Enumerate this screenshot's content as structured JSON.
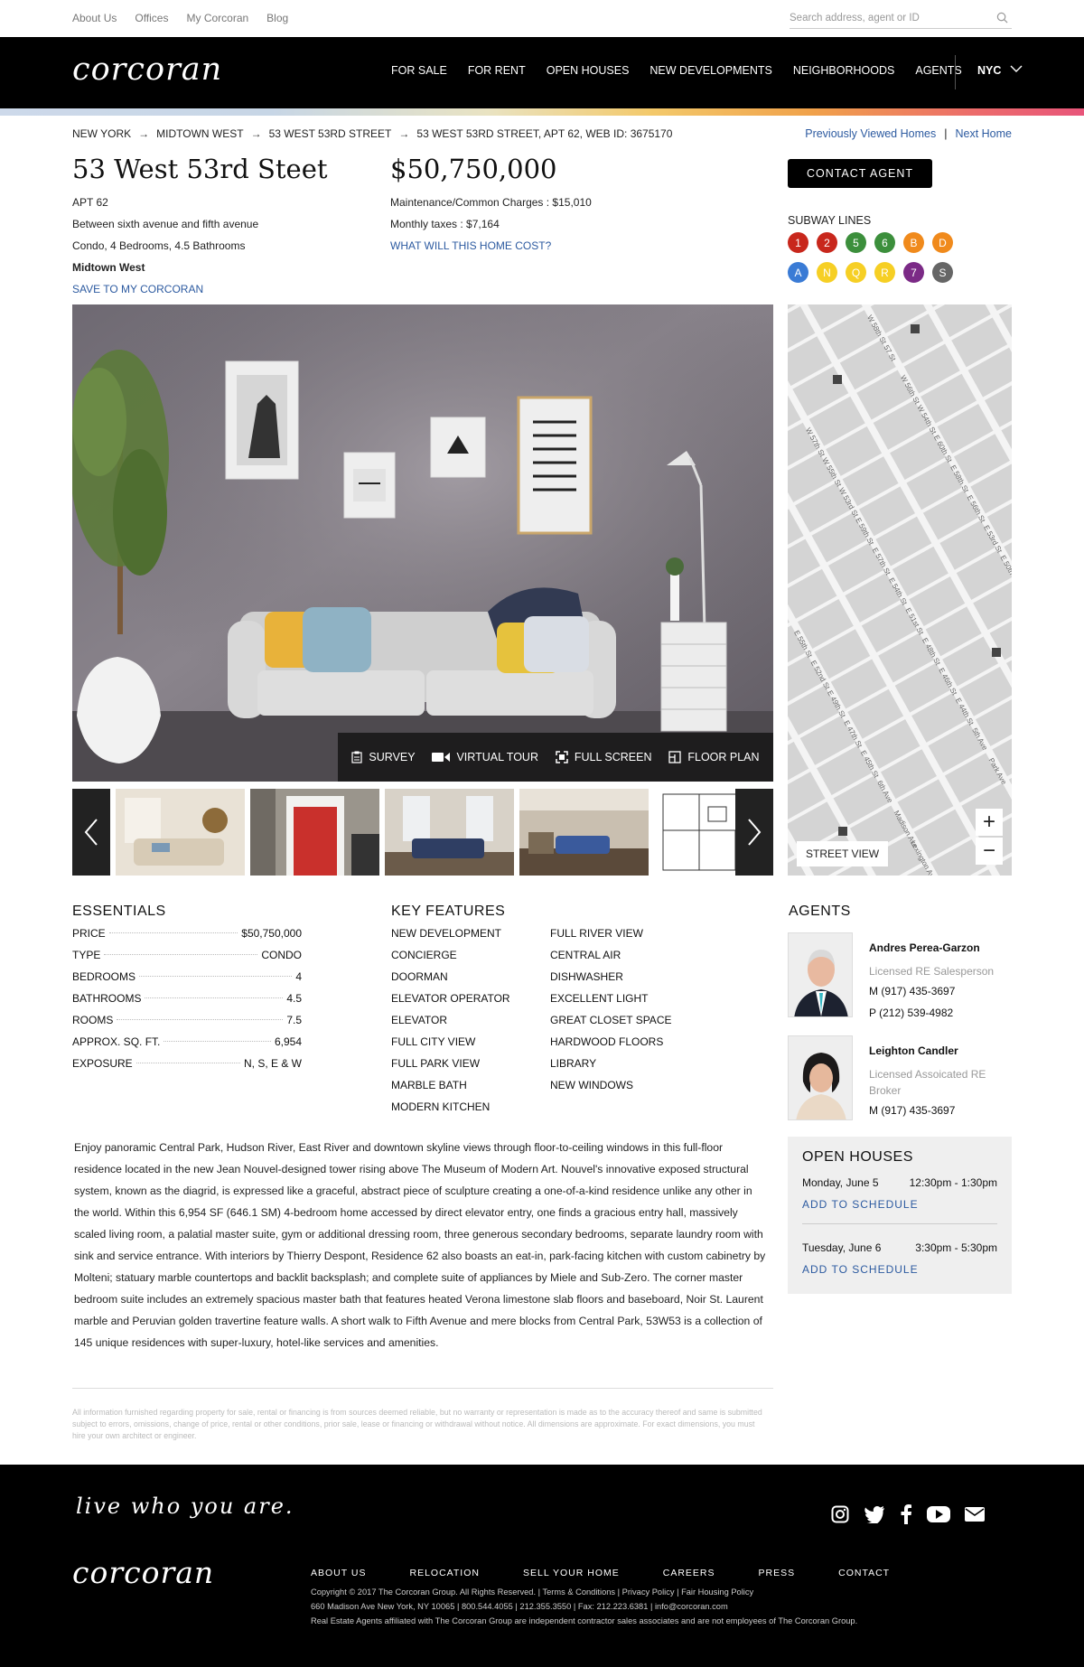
{
  "util": {
    "links": [
      "About Us",
      "Offices",
      "My Corcoran",
      "Blog"
    ],
    "search_placeholder": "Search address, agent or ID"
  },
  "header": {
    "logo": "corcoran",
    "nav": [
      "FOR SALE",
      "FOR RENT",
      "OPEN HOUSES",
      "NEW DEVELOPMENTS",
      "NEIGHBORHOODS",
      "AGENTS"
    ],
    "city": "NYC"
  },
  "breadcrumb": {
    "items": [
      "NEW YORK",
      "MIDTOWN WEST",
      "53 WEST 53RD STREET",
      "53 WEST 53RD STREET, APT 62, WEB ID: 3675170"
    ],
    "previously_viewed": "Previously Viewed Homes",
    "next_home": "Next Home"
  },
  "listing": {
    "title": "53 West 53rd Steet",
    "apt": "APT 62",
    "between": "Between sixth avenue and fifth avenue",
    "summary": "Condo, 4 Bedrooms, 4.5 Bathrooms",
    "neighborhood": "Midtown West",
    "save": "SAVE TO MY CORCORAN",
    "price": "$50,750,000",
    "maintenance": "Maintenance/Common Charges : $15,010",
    "taxes": "Monthly taxes : $7,164",
    "cost_link": "WHAT WILL THIS HOME COST?",
    "contact": "CONTACT AGENT"
  },
  "subway": {
    "label": "SUBWAY LINES",
    "lines": [
      {
        "n": "1",
        "c": "#c8271c"
      },
      {
        "n": "2",
        "c": "#c8271c"
      },
      {
        "n": "5",
        "c": "#3c8f3c"
      },
      {
        "n": "6",
        "c": "#3c8f3c"
      },
      {
        "n": "B",
        "c": "#f08a1c"
      },
      {
        "n": "D",
        "c": "#f08a1c"
      },
      {
        "n": "A",
        "c": "#3a7bd5"
      },
      {
        "n": "N",
        "c": "#f6cf24"
      },
      {
        "n": "Q",
        "c": "#f6cf24"
      },
      {
        "n": "R",
        "c": "#f6cf24"
      },
      {
        "n": "7",
        "c": "#7b2a86"
      },
      {
        "n": "S",
        "c": "#666666"
      }
    ]
  },
  "media": {
    "survey": "SURVEY",
    "virtual_tour": "VIRTUAL TOUR",
    "full_screen": "FULL SCREEN",
    "floor_plan": "FLOOR PLAN"
  },
  "map": {
    "street_view": "STREET VIEW",
    "labels": [
      "W 58th St",
      "57 St",
      "W 57th St",
      "W 56th St",
      "W 55th St",
      "W 54th St",
      "W 53rd St",
      "E 60th St",
      "E 59th St",
      "E 58th St",
      "E 57th St",
      "E 56th St",
      "E 55th St",
      "E 54th St",
      "E 53rd St",
      "E 52nd St",
      "E 51st St",
      "E 50th St",
      "E 49th St",
      "E 48th St",
      "E 47th St",
      "E 46th St",
      "E 45th St",
      "E 44th St",
      "6th Ave",
      "5th Ave",
      "Madison Ave",
      "Park Ave",
      "Lexington Ave",
      "51 Street",
      "5 Av Subway",
      "ntral Terminal"
    ]
  },
  "essentials": {
    "heading": "ESSENTIALS",
    "rows": [
      {
        "k": "PRICE",
        "v": "$50,750,000"
      },
      {
        "k": "TYPE",
        "v": "CONDO"
      },
      {
        "k": "BEDROOMS",
        "v": "4"
      },
      {
        "k": "BATHROOMS",
        "v": "4.5"
      },
      {
        "k": "ROOMS",
        "v": "7.5"
      },
      {
        "k": "APPROX. SQ. FT.",
        "v": "6,954"
      },
      {
        "k": "EXPOSURE",
        "v": "N, S, E & W"
      }
    ]
  },
  "features": {
    "heading": "KEY FEATURES",
    "col1": [
      "NEW DEVELOPMENT",
      "CONCIERGE",
      "DOORMAN",
      "ELEVATOR OPERATOR",
      "ELEVATOR",
      "FULL CITY VIEW",
      "FULL PARK VIEW",
      "MARBLE BATH",
      "MODERN KITCHEN"
    ],
    "col2": [
      "FULL RIVER VIEW",
      "CENTRAL AIR",
      "DISHWASHER",
      "EXCELLENT LIGHT",
      "GREAT CLOSET SPACE",
      "HARDWOOD FLOORS",
      "LIBRARY",
      "NEW WINDOWS"
    ]
  },
  "description": "Enjoy panoramic Central Park, Hudson River, East River and downtown skyline views through floor-to-ceiling windows in this full-floor residence located in the new Jean Nouvel-designed tower rising above The Museum of Modern Art. Nouvel's innovative exposed structural system, known as the diagrid, is expressed like a graceful, abstract piece of sculpture creating a one-of-a-kind residence unlike any other in the world. Within this 6,954 SF (646.1 SM) 4-bedroom home accessed by direct elevator entry, one finds a gracious entry hall, massively scaled living room, a palatial master suite, gym or additional dressing room, three generous secondary bedrooms, separate laundry room with sink and service entrance. With interiors by Thierry Despont, Residence 62 also boasts an eat-in, park-facing kitchen with custom cabinetry by Molteni; statuary marble countertops and backlit backsplash; and complete suite of appliances by Miele and Sub-Zero. The corner master bedroom suite includes an extremely spacious master bath that features heated Verona limestone slab floors and baseboard, Noir St. Laurent marble and Peruvian golden travertine feature walls. A short walk to Fifth Avenue and mere blocks from Central Park, 53W53 is a collection of 145 unique residences with super-luxury, hotel-like services and amenities.",
  "disclaimer": "All information furnished regarding property for sale, rental or financing is from sources deemed reliable, but no warranty or representation is made as to the accuracy thereof and same is submitted subject to errors, omissions, change of price, rental or other conditions, prior sale, lease or financing or withdrawal without notice. All dimensions are approximate. For exact dimensions, you must hire your own architect or engineer.",
  "agents": {
    "heading": "AGENTS",
    "list": [
      {
        "name": "Andres Perea-Garzon",
        "role": "Licensed RE Salesperson",
        "mobile": "M (917) 435-3697",
        "phone": "P (212) 539-4982"
      },
      {
        "name": "Leighton Candler",
        "role": "Licensed Assoicated RE Broker",
        "mobile": "M (917) 435-3697"
      }
    ]
  },
  "open_houses": {
    "heading": "OPEN HOUSES",
    "add": "ADD TO SCHEDULE",
    "list": [
      {
        "day": "Monday, June 5",
        "time": "12:30pm - 1:30pm"
      },
      {
        "day": "Tuesday, June 6",
        "time": "3:30pm - 5:30pm"
      }
    ]
  },
  "footer": {
    "tagline": "live who you are.",
    "logo": "corcoran",
    "nav": [
      "ABOUT US",
      "RELOCATION",
      "SELL YOUR HOME",
      "CAREERS",
      "PRESS",
      "CONTACT"
    ],
    "copyright": "Copyright © 2017 The Corcoran Group. All Rights Reserved. | Terms & Conditions | Privacy Policy | Fair Housing Policy",
    "address": "660 Madison Ave New York, NY 10065 | 800.544.4055 | 212.355.3550 | Fax: 212.223.6381 | info@corcoran.com",
    "note": "Real Estate Agents affiliated with The Corcoran Group are independent contractor sales associates and are not employees of The Corcoran Group.",
    "social": [
      "instagram-icon",
      "twitter-icon",
      "facebook-icon",
      "youtube-icon",
      "mail-icon"
    ]
  }
}
